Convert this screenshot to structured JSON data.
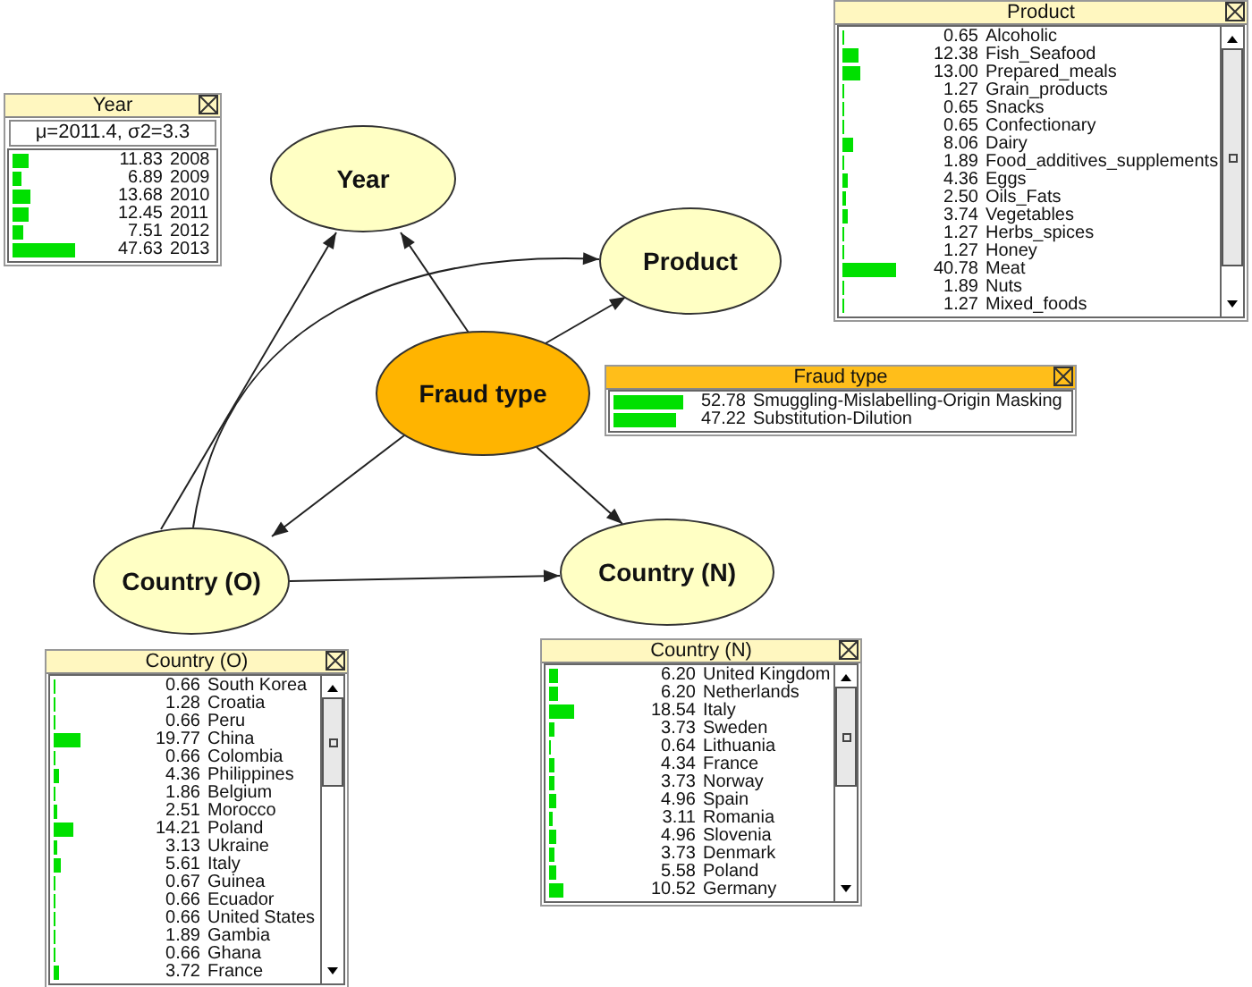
{
  "nodes": [
    {
      "name": "Year",
      "selected": false
    },
    {
      "name": "Product",
      "selected": false
    },
    {
      "name": "Fraud type",
      "selected": true
    },
    {
      "name": "Country (O)",
      "selected": false
    },
    {
      "name": "Country (N)",
      "selected": false
    }
  ],
  "monitors": [
    {
      "title": "Year",
      "selected": false,
      "scrollable": false,
      "stats": "μ=2011.4, σ2=3.3",
      "rows": [
        {
          "percent": "11.83",
          "state": "2008"
        },
        {
          "percent": "6.89",
          "state": "2009"
        },
        {
          "percent": "13.68",
          "state": "2010"
        },
        {
          "percent": "12.45",
          "state": "2011"
        },
        {
          "percent": "7.51",
          "state": "2012"
        },
        {
          "percent": "47.63",
          "state": "2013"
        }
      ]
    },
    {
      "title": "Product",
      "selected": false,
      "scrollable": true,
      "rows": [
        {
          "percent": "0.65",
          "state": "Alcoholic"
        },
        {
          "percent": "12.38",
          "state": "Fish_Seafood"
        },
        {
          "percent": "13.00",
          "state": "Prepared_meals"
        },
        {
          "percent": "1.27",
          "state": "Grain_products"
        },
        {
          "percent": "0.65",
          "state": "Snacks"
        },
        {
          "percent": "0.65",
          "state": "Confectionary"
        },
        {
          "percent": "8.06",
          "state": "Dairy"
        },
        {
          "percent": "1.89",
          "state": "Food_additives_supplements"
        },
        {
          "percent": "4.36",
          "state": "Eggs"
        },
        {
          "percent": "2.50",
          "state": "Oils_Fats"
        },
        {
          "percent": "3.74",
          "state": "Vegetables"
        },
        {
          "percent": "1.27",
          "state": "Herbs_spices"
        },
        {
          "percent": "1.27",
          "state": "Honey"
        },
        {
          "percent": "40.78",
          "state": "Meat"
        },
        {
          "percent": "1.89",
          "state": "Nuts"
        },
        {
          "percent": "1.27",
          "state": "Mixed_foods"
        }
      ]
    },
    {
      "title": "Fraud type",
      "selected": true,
      "scrollable": false,
      "rows": [
        {
          "percent": "52.78",
          "state": "Smuggling-Mislabelling-Origin Masking"
        },
        {
          "percent": "47.22",
          "state": "Substitution-Dilution"
        }
      ]
    },
    {
      "title": "Country (O)",
      "selected": false,
      "scrollable": true,
      "rows": [
        {
          "percent": "0.66",
          "state": "South Korea"
        },
        {
          "percent": "1.28",
          "state": "Croatia"
        },
        {
          "percent": "0.66",
          "state": "Peru"
        },
        {
          "percent": "19.77",
          "state": "China"
        },
        {
          "percent": "0.66",
          "state": "Colombia"
        },
        {
          "percent": "4.36",
          "state": "Philippines"
        },
        {
          "percent": "1.86",
          "state": "Belgium"
        },
        {
          "percent": "2.51",
          "state": "Morocco"
        },
        {
          "percent": "14.21",
          "state": "Poland"
        },
        {
          "percent": "3.13",
          "state": "Ukraine"
        },
        {
          "percent": "5.61",
          "state": "Italy"
        },
        {
          "percent": "0.67",
          "state": "Guinea"
        },
        {
          "percent": "0.66",
          "state": "Ecuador"
        },
        {
          "percent": "0.66",
          "state": "United States"
        },
        {
          "percent": "1.89",
          "state": "Gambia"
        },
        {
          "percent": "0.66",
          "state": "Ghana"
        },
        {
          "percent": "3.72",
          "state": "France"
        }
      ]
    },
    {
      "title": "Country (N)",
      "selected": false,
      "scrollable": true,
      "rows": [
        {
          "percent": "6.20",
          "state": "United Kingdom"
        },
        {
          "percent": "6.20",
          "state": "Netherlands"
        },
        {
          "percent": "18.54",
          "state": "Italy"
        },
        {
          "percent": "3.73",
          "state": "Sweden"
        },
        {
          "percent": "0.64",
          "state": "Lithuania"
        },
        {
          "percent": "4.34",
          "state": "France"
        },
        {
          "percent": "3.73",
          "state": "Norway"
        },
        {
          "percent": "4.96",
          "state": "Spain"
        },
        {
          "percent": "3.11",
          "state": "Romania"
        },
        {
          "percent": "4.96",
          "state": "Slovenia"
        },
        {
          "percent": "3.73",
          "state": "Denmark"
        },
        {
          "percent": "5.58",
          "state": "Poland"
        },
        {
          "percent": "10.52",
          "state": "Germany"
        }
      ]
    }
  ]
}
